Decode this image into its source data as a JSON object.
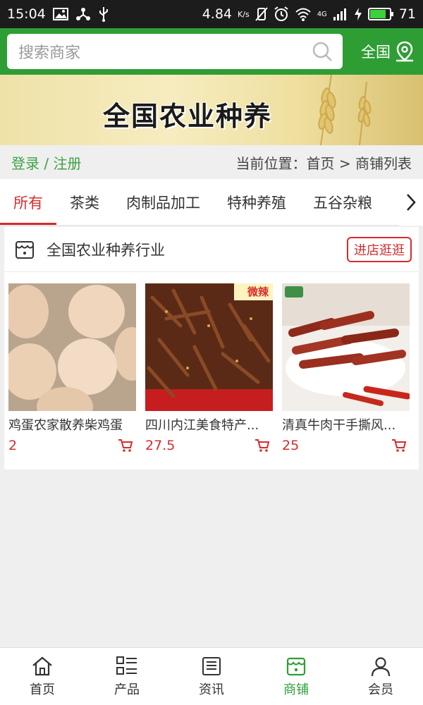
{
  "status_bar": {
    "time": "15:04",
    "speed": "4.84",
    "speed_unit": "K/s",
    "network": "4G",
    "battery": "71"
  },
  "search": {
    "placeholder": "搜索商家",
    "region_label": "全国"
  },
  "banner": {
    "title": "全国农业种养"
  },
  "breadcrumb": {
    "login_register": "登录 / 注册",
    "location": "当前位置：首页 > 商铺列表"
  },
  "tabs": [
    {
      "label": "所有",
      "active": true
    },
    {
      "label": "茶类",
      "active": false
    },
    {
      "label": "肉制品加工",
      "active": false
    },
    {
      "label": "特种养殖",
      "active": false
    },
    {
      "label": "五谷杂粮",
      "active": false
    }
  ],
  "shop": {
    "name": "全国农业种养行业",
    "visit_label": "进店逛逛",
    "products": [
      {
        "name": "鸡蛋农家散养柴鸡蛋",
        "price": "2"
      },
      {
        "name": "四川内江美食特产...",
        "price": "27.5",
        "badge": "微辣"
      },
      {
        "name": "清真牛肉干手撕风...",
        "price": "25"
      }
    ]
  },
  "bottom_nav": [
    {
      "label": "首页",
      "icon": "home-icon",
      "active": false
    },
    {
      "label": "产品",
      "icon": "list-icon",
      "active": false
    },
    {
      "label": "资讯",
      "icon": "news-icon",
      "active": false
    },
    {
      "label": "商铺",
      "icon": "shop-icon",
      "active": true
    },
    {
      "label": "会员",
      "icon": "user-icon",
      "active": false
    }
  ],
  "colors": {
    "brand_green": "#2e9e34",
    "accent_red": "#d62c2c"
  }
}
